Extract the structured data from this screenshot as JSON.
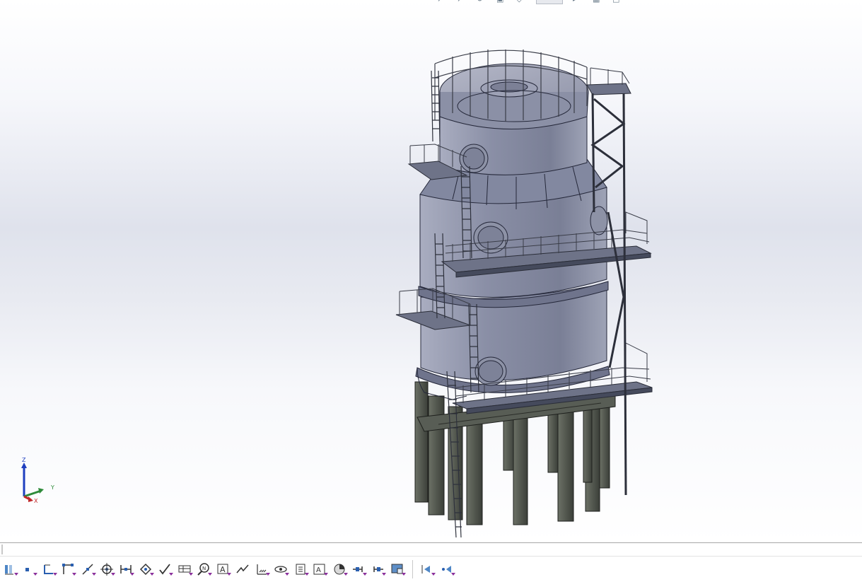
{
  "viewport": {
    "background_top": "#ffffff",
    "background_mid": "#dfe2ec",
    "model_color": "#8e93a8",
    "leg_color": "#4a4f47"
  },
  "triad": {
    "z_label": "Z",
    "y_label": "Y",
    "x_label": "X",
    "z_color": "#1f3fbf",
    "y_color": "#2e8b3a",
    "x_color": "#c0282a"
  },
  "heads_up_toolbar": {
    "icons": [
      "zoom-to-fit-icon",
      "zoom-area-icon",
      "previous-view-icon",
      "section-view-icon",
      "view-orientation-icon",
      "display-style-icon",
      "hide-show-icon",
      "appearance-icon",
      "scene-icon",
      "view-settings-icon"
    ]
  },
  "command_bar": {
    "dropdown_color": "#8a2f9c",
    "groups": [
      [
        "smart-dimension-icon",
        "point-icon",
        "trim-icon",
        "corner-icon",
        "line-icon",
        "target-icon",
        "mirror-icon",
        "tag-icon",
        "check-icon",
        "table-icon",
        "magnifier-n-icon",
        "text-a-icon",
        "slope-icon",
        "hatch-icon",
        "eye-icon",
        "clock-icon",
        "image-a-icon",
        "pie-icon",
        "arrow-left-icon",
        "arrow-right-icon",
        "screen-icon"
      ],
      [
        "add-on-1-icon",
        "add-on-2-icon"
      ]
    ]
  }
}
